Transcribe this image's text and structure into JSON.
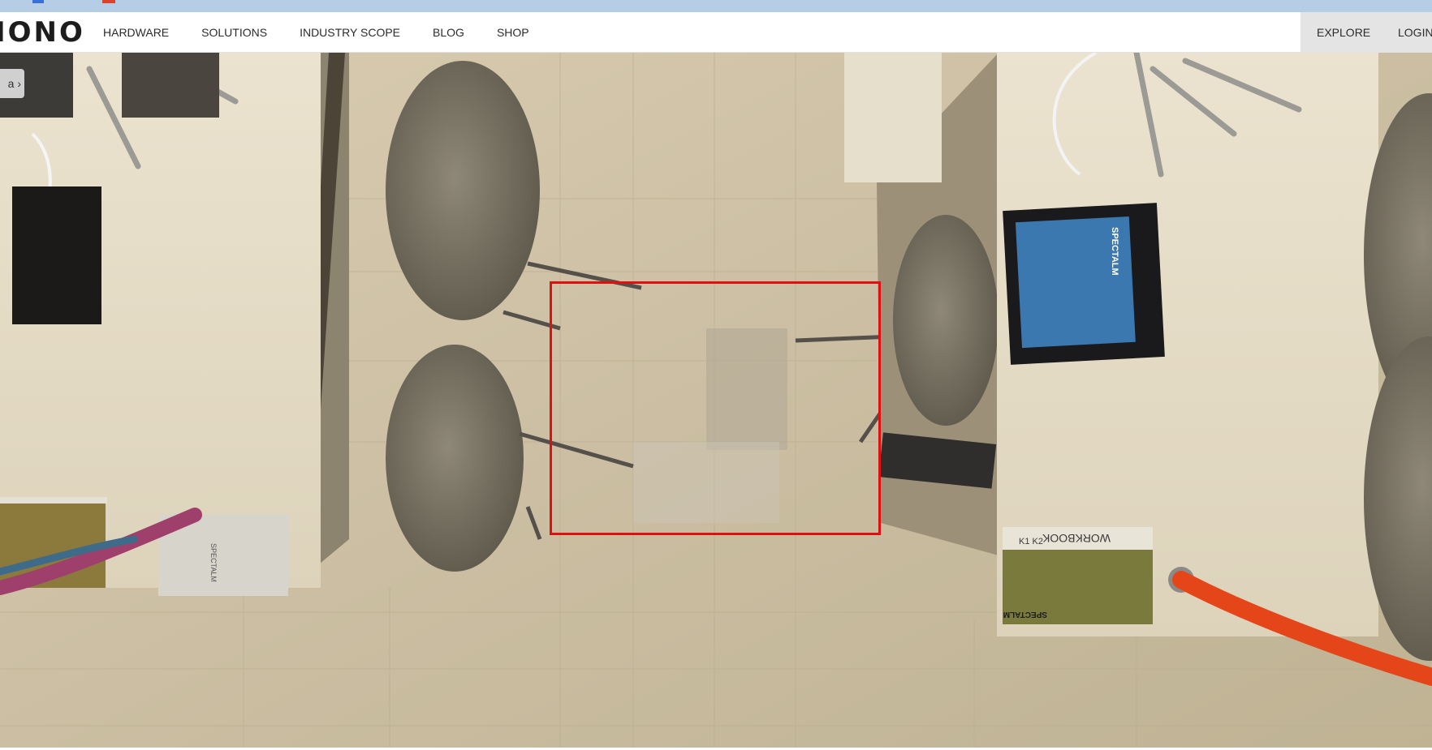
{
  "header": {
    "logo_text": "IONO",
    "nav": [
      {
        "label": "HARDWARE"
      },
      {
        "label": "SOLUTIONS"
      },
      {
        "label": "INDUSTRY SCOPE"
      },
      {
        "label": "BLOG"
      },
      {
        "label": "SHOP"
      }
    ],
    "explore_label": "EXPLORE",
    "login_label": "LOGIN"
  },
  "viewer": {
    "side_tab_glyph": "a ›",
    "scene_text": {
      "tablet_brand": "SPECTALM",
      "workbook_title": "WORKBOOK",
      "workbook_subtitle": "K1 K2",
      "workbook_brand": "SPECTALM",
      "card_brand": "SPECTALM"
    }
  },
  "colors": {
    "selection_border": "#e01010",
    "browser_strip": "#b6cde6",
    "nav_highlight": "#e4e4e4"
  }
}
